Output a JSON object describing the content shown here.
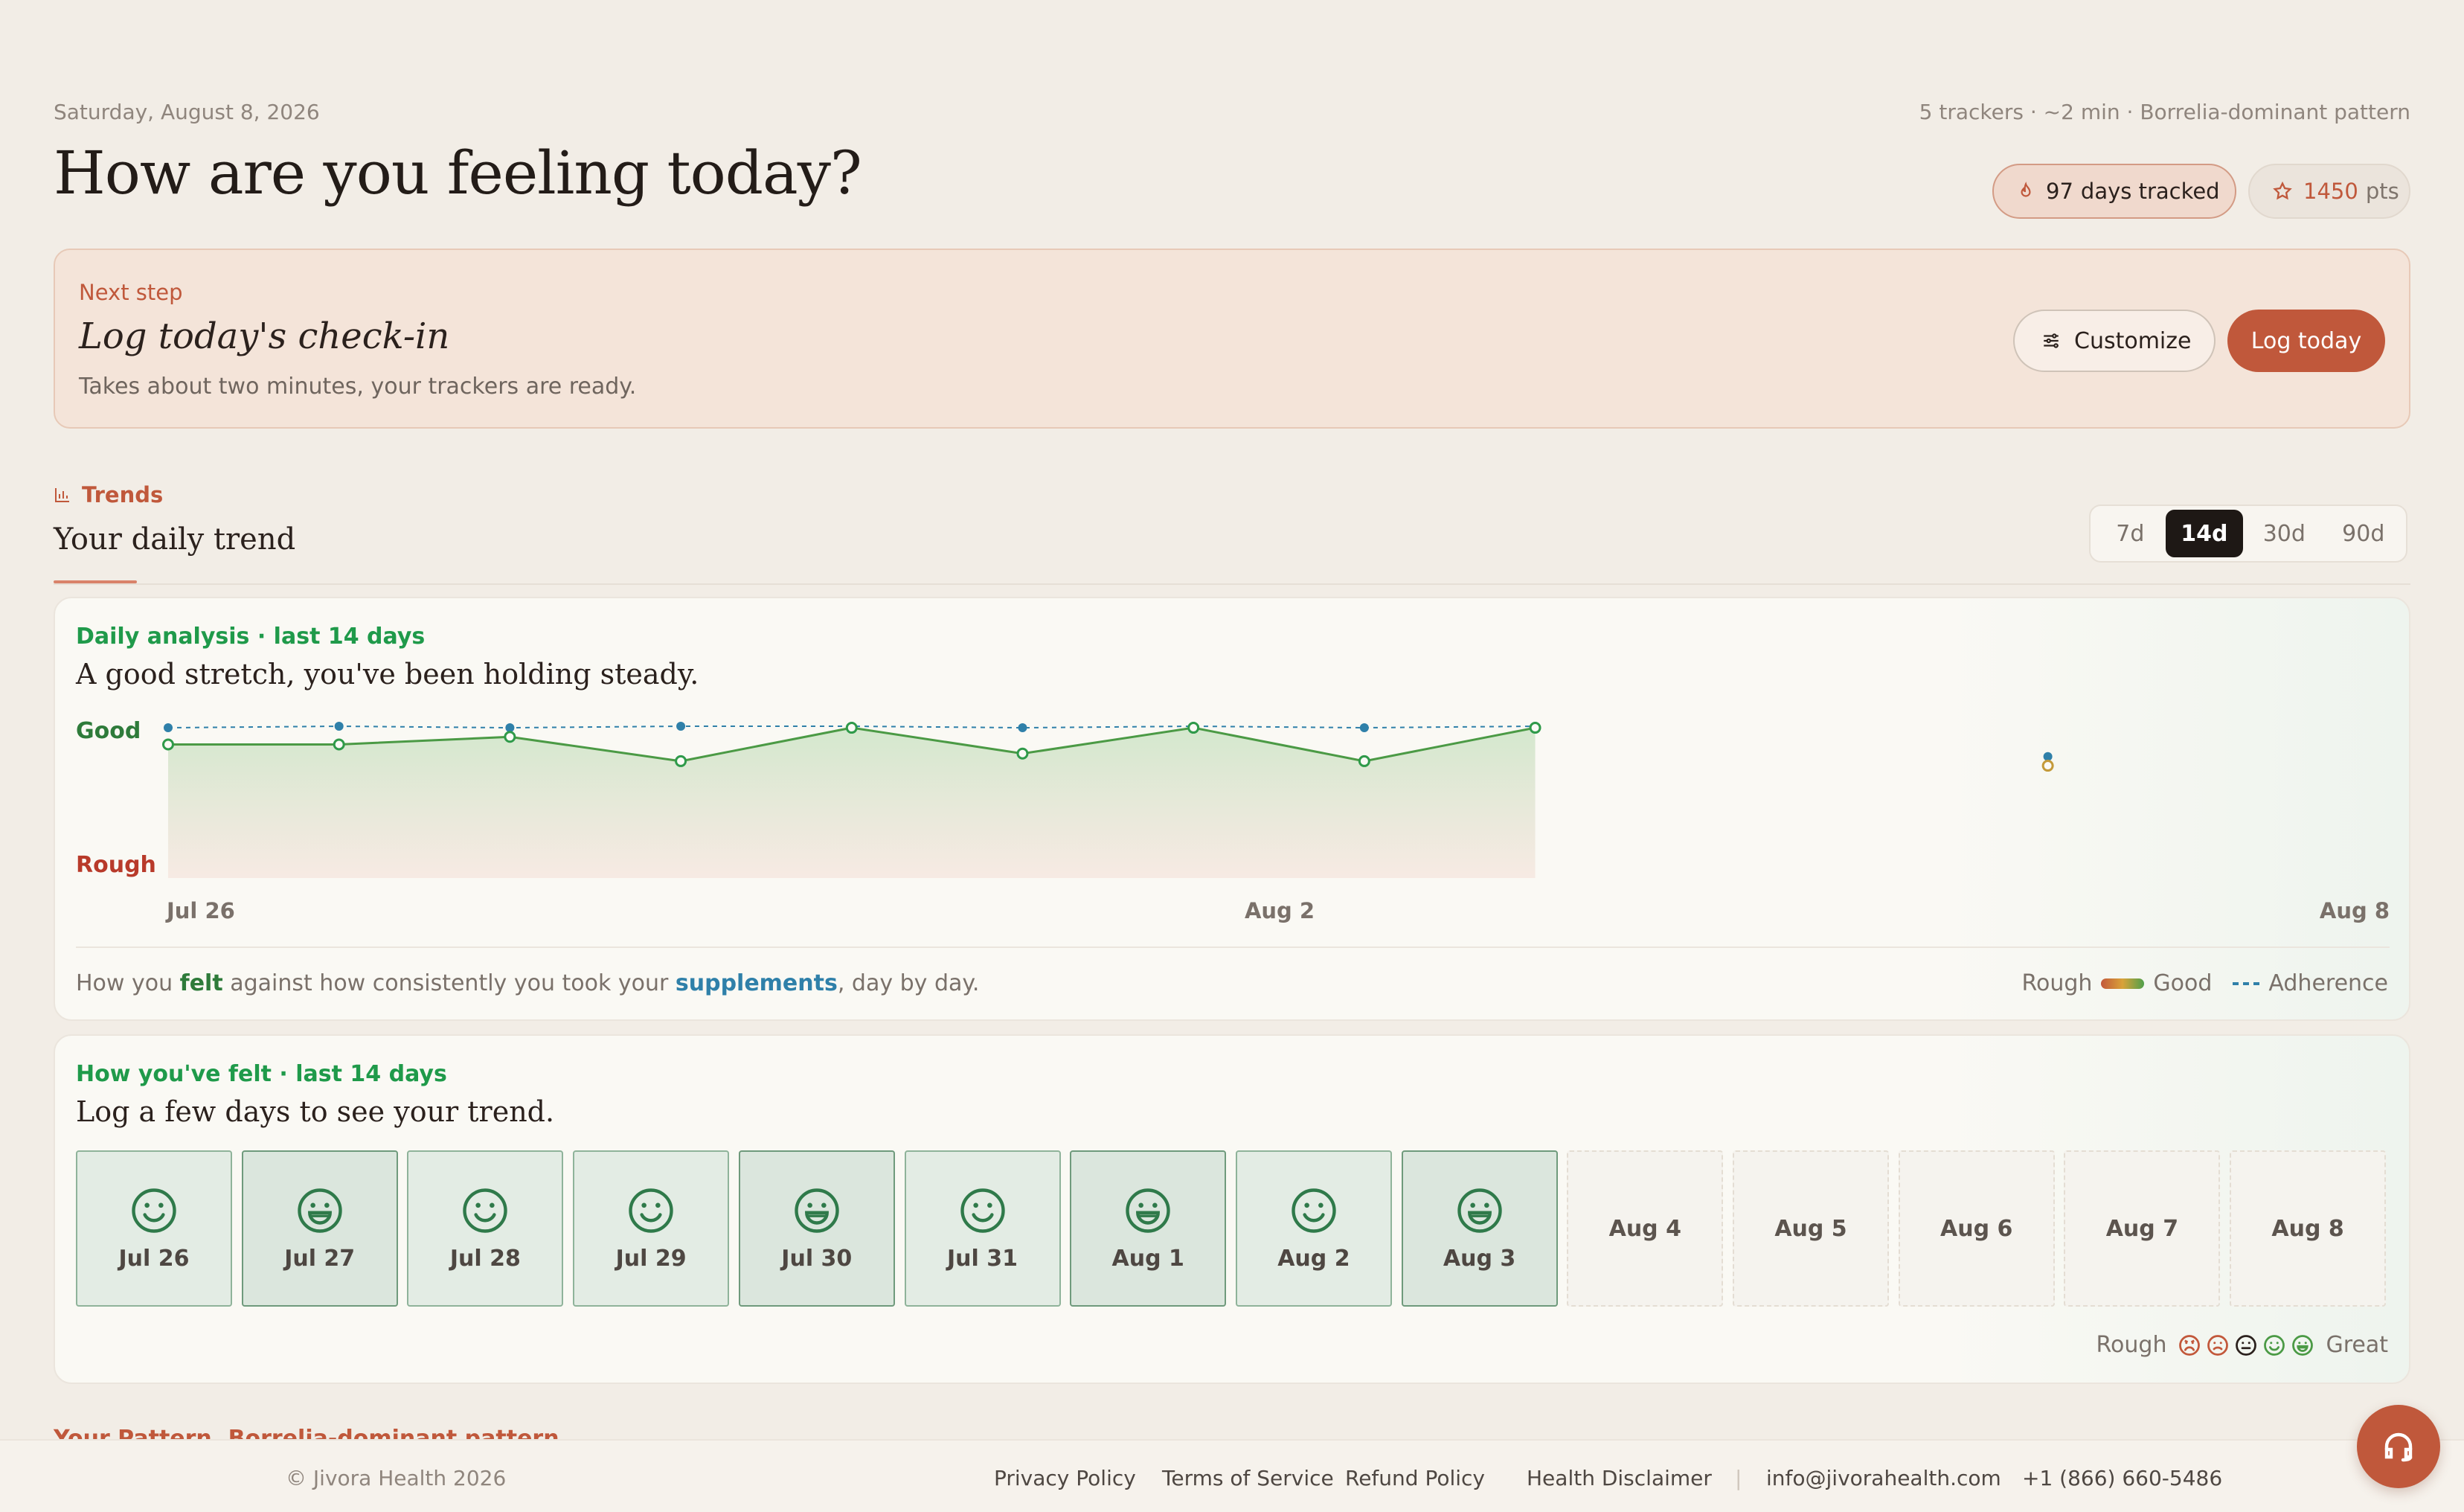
{
  "header": {
    "date": "Saturday, August 8, 2026",
    "meta": "5 trackers · ~2 min · Borrelia-dominant pattern",
    "title": "How are you feeling today?",
    "streak": {
      "value": "97",
      "label": "days tracked",
      "icon": "flame-icon"
    },
    "points": {
      "value": "1450",
      "label": "pts",
      "icon": "star-icon"
    }
  },
  "next_step": {
    "label": "Next step",
    "title": "Log today's check-in",
    "subtitle": "Takes about two minutes, your trackers are ready.",
    "customize_label": "Customize",
    "log_label": "Log today"
  },
  "trends": {
    "label": "Trends",
    "title": "Your daily trend",
    "ranges": [
      "7d",
      "14d",
      "30d",
      "90d"
    ],
    "active_range": "14d"
  },
  "analysis": {
    "label": "Daily analysis · last 14 days",
    "title": "A good stretch, you've been holding steady.",
    "caption_parts": [
      "How you ",
      "felt",
      " against how consistently you took your ",
      "supplements",
      ", day by day."
    ],
    "legend": {
      "rough": "Rough",
      "good": "Good",
      "adherence": "Adherence"
    }
  },
  "chart_data": {
    "type": "line",
    "y_top_label": "Good",
    "y_bottom_label": "Rough",
    "x_tick_labels": [
      "Jul 26",
      "Aug 2",
      "Aug 8"
    ],
    "x": [
      "Jul 26",
      "Jul 27",
      "Jul 28",
      "Jul 29",
      "Jul 30",
      "Jul 31",
      "Aug 1",
      "Aug 2",
      "Aug 3",
      "Aug 4",
      "Aug 5",
      "Aug 6",
      "Aug 7",
      "Aug 8"
    ],
    "ylim": [
      0,
      1
    ],
    "series": [
      {
        "key": "feeling",
        "values": [
          0.88,
          0.88,
          0.93,
          0.77,
          0.99,
          0.82,
          0.99,
          0.77,
          0.99,
          null,
          null,
          0.74,
          null,
          null
        ],
        "color": "#4b9a45"
      },
      {
        "key": "adherence",
        "values": [
          0.99,
          1.0,
          0.99,
          1.0,
          1.0,
          0.99,
          1.0,
          0.99,
          1.0,
          null,
          null,
          0.8,
          null,
          null
        ],
        "color": "#2f80a9"
      }
    ]
  },
  "mood": {
    "label": "How you've felt · last 14 days",
    "title": "Log a few days to see your trend.",
    "days": [
      {
        "date": "Jul 26",
        "level": 4
      },
      {
        "date": "Jul 27",
        "level": 5
      },
      {
        "date": "Jul 28",
        "level": 4
      },
      {
        "date": "Jul 29",
        "level": 4
      },
      {
        "date": "Jul 30",
        "level": 5
      },
      {
        "date": "Jul 31",
        "level": 4
      },
      {
        "date": "Aug 1",
        "level": 5
      },
      {
        "date": "Aug 2",
        "level": 4
      },
      {
        "date": "Aug 3",
        "level": 5
      },
      {
        "date": "Aug 4",
        "level": null
      },
      {
        "date": "Aug 5",
        "level": null
      },
      {
        "date": "Aug 6",
        "level": null
      },
      {
        "date": "Aug 7",
        "level": null
      },
      {
        "date": "Aug 8",
        "level": null
      }
    ],
    "legend_low": "Rough",
    "legend_high": "Great",
    "scale_colors": [
      "#c2583b",
      "#c2583b",
      "#2b211d",
      "#4b9a45",
      "#4b9a45"
    ]
  },
  "pattern_peek": "Your Pattern, Borrelia-dominant pattern",
  "footer": {
    "copyright": "© Jivora Health 2026",
    "links": [
      "Privacy Policy",
      "Terms of Service",
      "Refund Policy",
      "Health Disclaimer"
    ],
    "email": "info@jivorahealth.com",
    "phone": "+1 (866) 660-5486"
  },
  "colors": {
    "accent": "#c0583b",
    "good": "#1f9a4a",
    "adherence": "#2f80a9",
    "rough": "#b83a2a"
  }
}
